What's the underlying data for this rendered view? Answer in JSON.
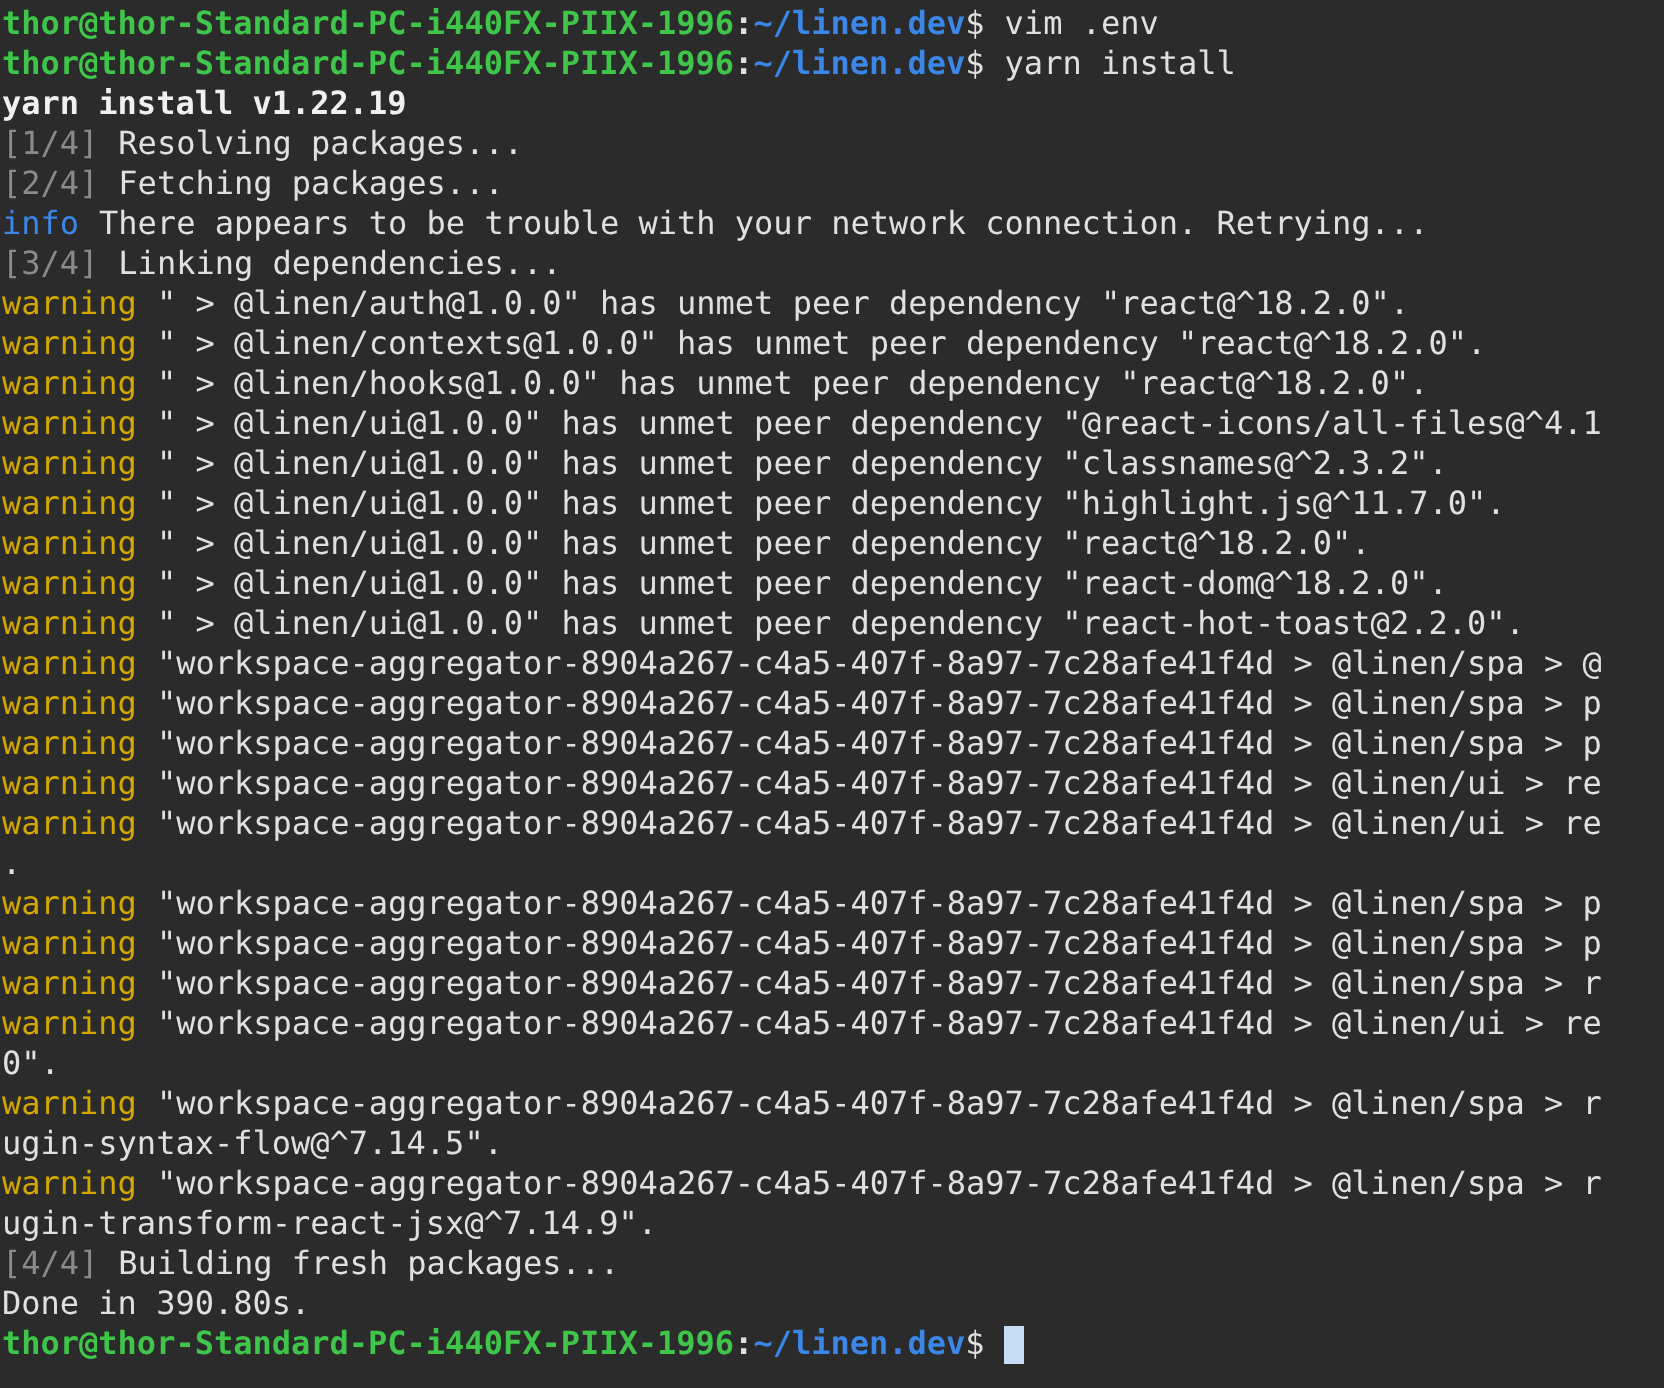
{
  "terminal": {
    "lines": [
      {
        "kind": "prompt",
        "host": "thor@thor-Standard-PC-i440FX-PIIX-1996",
        "separator": ":",
        "path": "~/linen.dev",
        "symbol": "$",
        "command": "vim .env",
        "cursor": false
      },
      {
        "kind": "prompt",
        "host": "thor@thor-Standard-PC-i440FX-PIIX-1996",
        "separator": ":",
        "path": "~/linen.dev",
        "symbol": "$",
        "command": "yarn install",
        "cursor": false
      },
      {
        "kind": "heading",
        "text": "yarn install v1.22.19"
      },
      {
        "kind": "step",
        "step": "[1/4]",
        "text": "Resolving packages..."
      },
      {
        "kind": "step",
        "step": "[2/4]",
        "text": "Fetching packages..."
      },
      {
        "kind": "info",
        "level": "info",
        "text": "There appears to be trouble with your network connection. Retrying..."
      },
      {
        "kind": "step",
        "step": "[3/4]",
        "text": "Linking dependencies..."
      },
      {
        "kind": "warning",
        "level": "warning",
        "text": "\" > @linen/auth@1.0.0\" has unmet peer dependency \"react@^18.2.0\"."
      },
      {
        "kind": "warning",
        "level": "warning",
        "text": "\" > @linen/contexts@1.0.0\" has unmet peer dependency \"react@^18.2.0\"."
      },
      {
        "kind": "warning",
        "level": "warning",
        "text": "\" > @linen/hooks@1.0.0\" has unmet peer dependency \"react@^18.2.0\"."
      },
      {
        "kind": "warning",
        "level": "warning",
        "text": "\" > @linen/ui@1.0.0\" has unmet peer dependency \"@react-icons/all-files@^4.1"
      },
      {
        "kind": "warning",
        "level": "warning",
        "text": "\" > @linen/ui@1.0.0\" has unmet peer dependency \"classnames@^2.3.2\"."
      },
      {
        "kind": "warning",
        "level": "warning",
        "text": "\" > @linen/ui@1.0.0\" has unmet peer dependency \"highlight.js@^11.7.0\"."
      },
      {
        "kind": "warning",
        "level": "warning",
        "text": "\" > @linen/ui@1.0.0\" has unmet peer dependency \"react@^18.2.0\"."
      },
      {
        "kind": "warning",
        "level": "warning",
        "text": "\" > @linen/ui@1.0.0\" has unmet peer dependency \"react-dom@^18.2.0\"."
      },
      {
        "kind": "warning",
        "level": "warning",
        "text": "\" > @linen/ui@1.0.0\" has unmet peer dependency \"react-hot-toast@2.2.0\"."
      },
      {
        "kind": "warning",
        "level": "warning",
        "text": "\"workspace-aggregator-8904a267-c4a5-407f-8a97-7c28afe41f4d > @linen/spa > @"
      },
      {
        "kind": "warning",
        "level": "warning",
        "text": "\"workspace-aggregator-8904a267-c4a5-407f-8a97-7c28afe41f4d > @linen/spa > p"
      },
      {
        "kind": "warning",
        "level": "warning",
        "text": "\"workspace-aggregator-8904a267-c4a5-407f-8a97-7c28afe41f4d > @linen/spa > p"
      },
      {
        "kind": "warning",
        "level": "warning",
        "text": "\"workspace-aggregator-8904a267-c4a5-407f-8a97-7c28afe41f4d > @linen/ui > re"
      },
      {
        "kind": "warning",
        "level": "warning",
        "text": "\"workspace-aggregator-8904a267-c4a5-407f-8a97-7c28afe41f4d > @linen/ui > re"
      },
      {
        "kind": "output",
        "text": "."
      },
      {
        "kind": "warning",
        "level": "warning",
        "text": "\"workspace-aggregator-8904a267-c4a5-407f-8a97-7c28afe41f4d > @linen/spa > p"
      },
      {
        "kind": "warning",
        "level": "warning",
        "text": "\"workspace-aggregator-8904a267-c4a5-407f-8a97-7c28afe41f4d > @linen/spa > p"
      },
      {
        "kind": "warning",
        "level": "warning",
        "text": "\"workspace-aggregator-8904a267-c4a5-407f-8a97-7c28afe41f4d > @linen/spa > r"
      },
      {
        "kind": "warning",
        "level": "warning",
        "text": "\"workspace-aggregator-8904a267-c4a5-407f-8a97-7c28afe41f4d > @linen/ui > re"
      },
      {
        "kind": "output",
        "text": "0\"."
      },
      {
        "kind": "warning",
        "level": "warning",
        "text": "\"workspace-aggregator-8904a267-c4a5-407f-8a97-7c28afe41f4d > @linen/spa > r"
      },
      {
        "kind": "output",
        "text": "ugin-syntax-flow@^7.14.5\"."
      },
      {
        "kind": "warning",
        "level": "warning",
        "text": "\"workspace-aggregator-8904a267-c4a5-407f-8a97-7c28afe41f4d > @linen/spa > r"
      },
      {
        "kind": "output",
        "text": "ugin-transform-react-jsx@^7.14.9\"."
      },
      {
        "kind": "step",
        "step": "[4/4]",
        "text": "Building fresh packages..."
      },
      {
        "kind": "output",
        "text": "Done in 390.80s."
      },
      {
        "kind": "prompt",
        "host": "thor@thor-Standard-PC-i440FX-PIIX-1996",
        "separator": ":",
        "path": "~/linen.dev",
        "symbol": "$",
        "cursor": true
      }
    ]
  }
}
